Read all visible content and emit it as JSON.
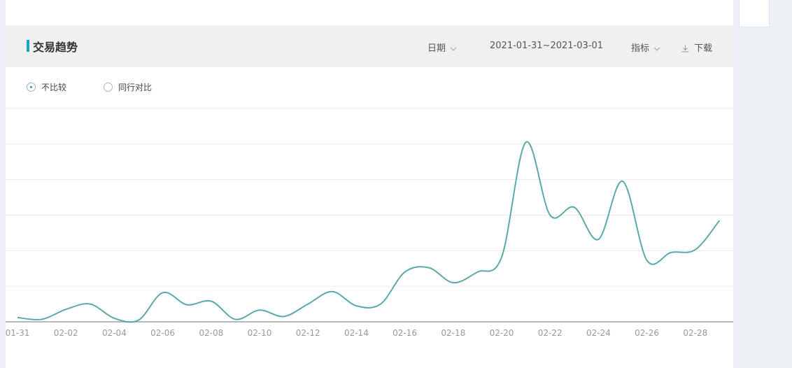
{
  "header": {
    "title": "交易趋势",
    "date_label": "日期",
    "date_range": "2021-01-31~2021-03-01",
    "metric_label": "指标",
    "download_label": "下载"
  },
  "compare": {
    "option_none": "不比较",
    "option_peer": "同行对比",
    "selected": "不比较"
  },
  "colors": {
    "accent": "#1aa3c4",
    "line": "#5aa9ab",
    "radio_dot": "#3f86c8"
  },
  "chart_data": {
    "type": "line",
    "title": "",
    "xlabel": "",
    "ylabel": "",
    "ylim": [
      0,
      6
    ],
    "grid": true,
    "x": [
      "01-31",
      "02-01",
      "02-02",
      "02-03",
      "02-04",
      "02-05",
      "02-06",
      "02-07",
      "02-08",
      "02-09",
      "02-10",
      "02-11",
      "02-12",
      "02-13",
      "02-14",
      "02-15",
      "02-16",
      "02-17",
      "02-18",
      "02-19",
      "02-20",
      "02-21",
      "02-22",
      "02-23",
      "02-24",
      "02-25",
      "02-26",
      "02-27",
      "02-28",
      "03-01"
    ],
    "x_tick_labels": [
      "01-31",
      "02-02",
      "02-04",
      "02-06",
      "02-08",
      "02-10",
      "02-12",
      "02-14",
      "02-16",
      "02-18",
      "02-20",
      "02-22",
      "02-24",
      "02-26",
      "02-28"
    ],
    "series": [
      {
        "values": [
          0.12,
          0.07,
          0.35,
          0.5,
          0.1,
          0.05,
          0.82,
          0.48,
          0.58,
          0.07,
          0.33,
          0.15,
          0.5,
          0.85,
          0.45,
          0.5,
          1.4,
          1.52,
          1.1,
          1.4,
          1.82,
          5.05,
          3.0,
          3.22,
          2.32,
          3.95,
          1.73,
          1.95,
          2.03,
          2.85
        ]
      }
    ]
  }
}
